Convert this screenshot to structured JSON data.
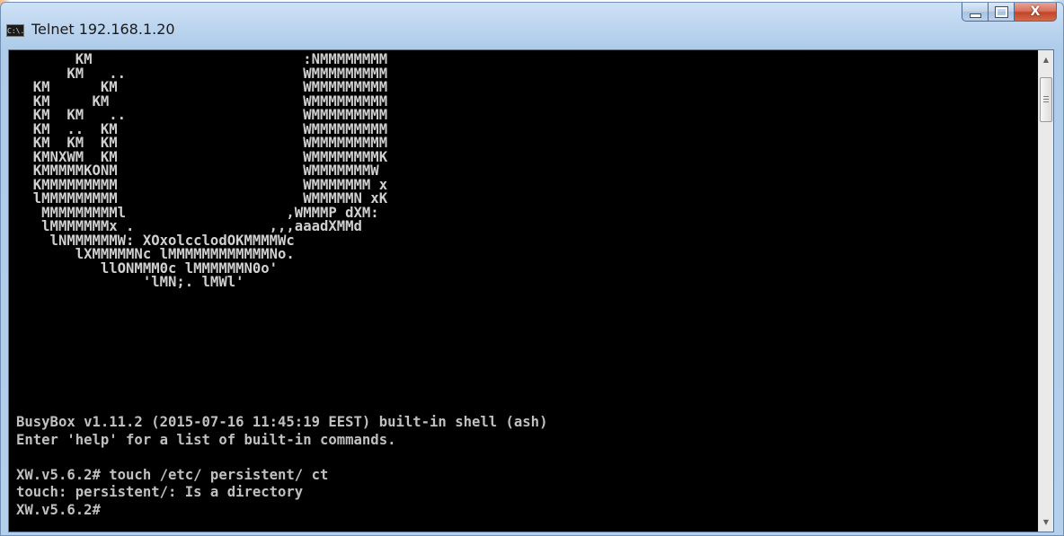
{
  "window": {
    "title": "Telnet 192.168.1.20",
    "icon": "console-icon",
    "icon_text": "C:\\."
  },
  "console": {
    "art_lines": [
      "       KM                         :NMMMMMMMM",
      "      KM   ..                     WMMMMMMMMM",
      "  KM      KM                      WMMMMMMMMM",
      "  KM     KM                       WMMMMMMMMM",
      "  KM  KM   ..                     WMMMMMMMMM",
      "  KM  ..  KM                      WMMMMMMMMM",
      "  KM  KM  KM                      WMMMMMMMMM",
      "  KMNXWM  KM                      WMMMMMMMMK",
      "  KMMMMMKONM                      WMMMMMMMW",
      "  KMMMMMMMMM                      WMMMMMMM x",
      "  lMMMMMMMMM                      WMMMMMN xK",
      "   MMMMMMMMMl                   ,WMMMP dXM:",
      "   lMMMMMMMx .                ,,,aaadXMMd",
      "    lNMMMMMMW: XOxolcclodOKMMMMWc",
      "       lXMMMMMNc lMMMMMMMMMMMMNo.",
      "          llONMMM0c lMMMMMMN0o'",
      "               'lMN;. lMWl'"
    ],
    "shell_lines": [
      "BusyBox v1.11.2 (2015-07-16 11:45:19 EEST) built-in shell (ash)",
      "Enter 'help' for a list of built-in commands.",
      "",
      "XW.v5.6.2# touch /etc/ persistent/ ct",
      "touch: persistent/: Is a directory",
      "XW.v5.6.2#"
    ]
  },
  "controls": {
    "minimize": "minimize-icon",
    "maximize": "maximize-icon",
    "close_glyph": "X",
    "scroll_up_glyph": "▲",
    "scroll_down_glyph": "▼"
  }
}
